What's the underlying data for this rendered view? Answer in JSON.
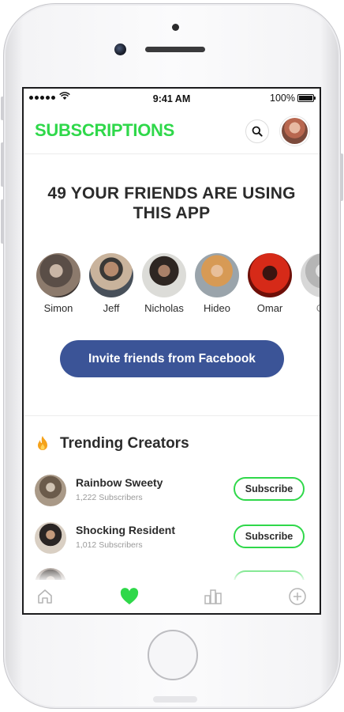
{
  "status_bar": {
    "time": "9:41 AM",
    "battery": "100%"
  },
  "header": {
    "title": "SUBSCRIPTIONS"
  },
  "headline": "49 YOUR FRIENDS ARE USING THIS APP",
  "friends": [
    {
      "name": "Simon"
    },
    {
      "name": "Jeff"
    },
    {
      "name": "Nicholas"
    },
    {
      "name": "Hideo"
    },
    {
      "name": "Omar"
    },
    {
      "name": "Co"
    }
  ],
  "invite_button": "Invite friends from Facebook",
  "trending": {
    "title": "Trending Creators",
    "creators": [
      {
        "name": "Rainbow Sweety",
        "subscribers": "1,222 Subscribers",
        "button": "Subscribe"
      },
      {
        "name": "Shocking Resident",
        "subscribers": "1,012 Subscribers",
        "button": "Subscribe"
      }
    ]
  },
  "tabbar": {
    "icons": [
      "home-icon",
      "heart-icon",
      "chart-icon",
      "add-icon"
    ],
    "active": "heart-icon"
  },
  "colors": {
    "accent": "#2fd84a",
    "facebook": "#3b5497",
    "text": "#2b2b2b"
  }
}
